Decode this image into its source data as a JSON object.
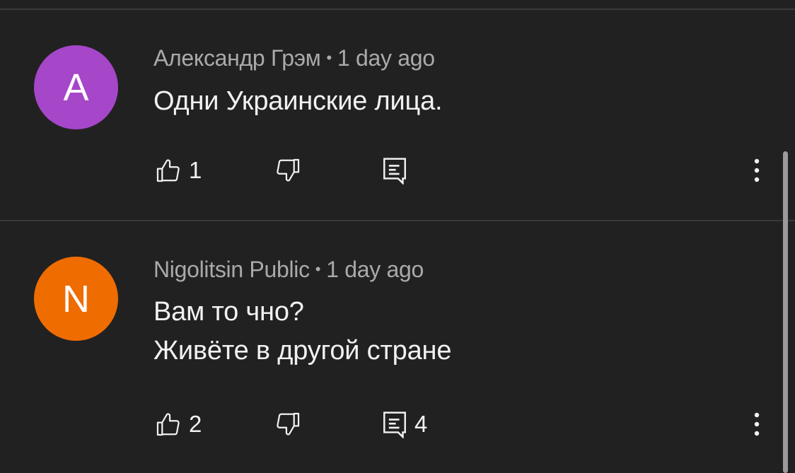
{
  "comments": [
    {
      "avatar_letter": "A",
      "avatar_color": "#a646c9",
      "author": "Александр Грэм",
      "separator": "•",
      "time": "1 day ago",
      "lines": [
        "Одни Украинские лица."
      ],
      "like_count": "1",
      "reply_count": ""
    },
    {
      "avatar_letter": "N",
      "avatar_color": "#ef6c00",
      "author": "Nigolitsin Public",
      "separator": "•",
      "time": "1 day ago",
      "lines": [
        "Вам то чно?",
        "Живёте в другой стране"
      ],
      "like_count": "2",
      "reply_count": "4"
    }
  ],
  "icons": {
    "like": "thumbs-up-icon",
    "dislike": "thumbs-down-icon",
    "reply": "comment-reply-icon",
    "more": "more-vertical-icon"
  },
  "colors": {
    "background": "#212121",
    "text_primary": "#f1f1f1",
    "text_secondary": "#aaaaaa",
    "divider": "#3a3a3a"
  }
}
